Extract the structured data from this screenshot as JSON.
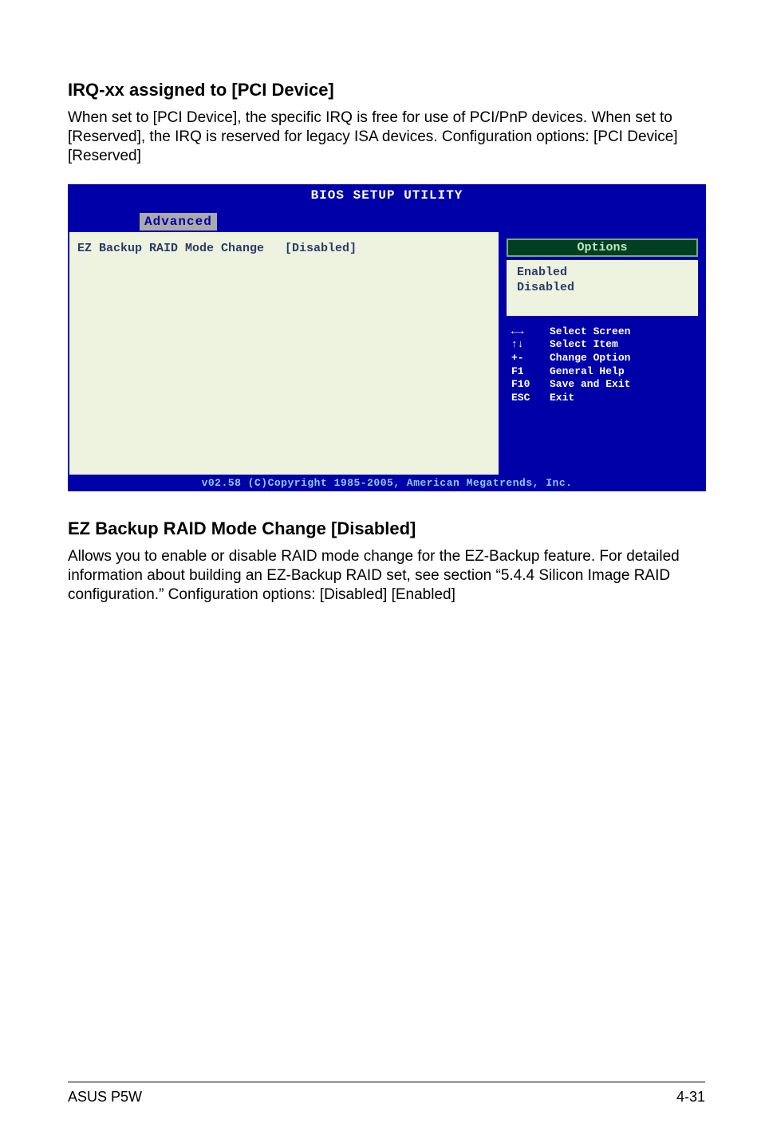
{
  "section1": {
    "title": "IRQ-xx assigned to [PCI Device]",
    "body": "When set to [PCI Device], the specific IRQ is free for use of PCI/PnP devices. When set to [Reserved], the IRQ is reserved for legacy ISA devices. Configuration options: [PCI Device] [Reserved]"
  },
  "bios": {
    "title": "BIOS SETUP UTILITY",
    "tab": "Advanced",
    "setting_label": "EZ Backup RAID Mode Change",
    "setting_value": "[Disabled]",
    "options_header": "Options",
    "options": [
      "Enabled",
      "Disabled"
    ],
    "nav": [
      {
        "key": "←→",
        "desc": "Select Screen"
      },
      {
        "key": "↑↓",
        "desc": "Select Item"
      },
      {
        "key": "+-",
        "desc": "Change Option"
      },
      {
        "key": "F1",
        "desc": "General Help"
      },
      {
        "key": "F10",
        "desc": "Save and Exit"
      },
      {
        "key": "ESC",
        "desc": "Exit"
      }
    ],
    "footer": "v02.58 (C)Copyright 1985-2005, American Megatrends, Inc."
  },
  "section2": {
    "title": "EZ Backup RAID Mode Change [Disabled]",
    "body": "Allows you to enable or disable RAID mode change for the EZ-Backup feature. For detailed information about building an EZ-Backup RAID set, see section “5.4.4 Silicon Image RAID configuration.” Configuration options: [Disabled] [Enabled]"
  },
  "footer": {
    "left": "ASUS P5W",
    "right": "4-31"
  }
}
